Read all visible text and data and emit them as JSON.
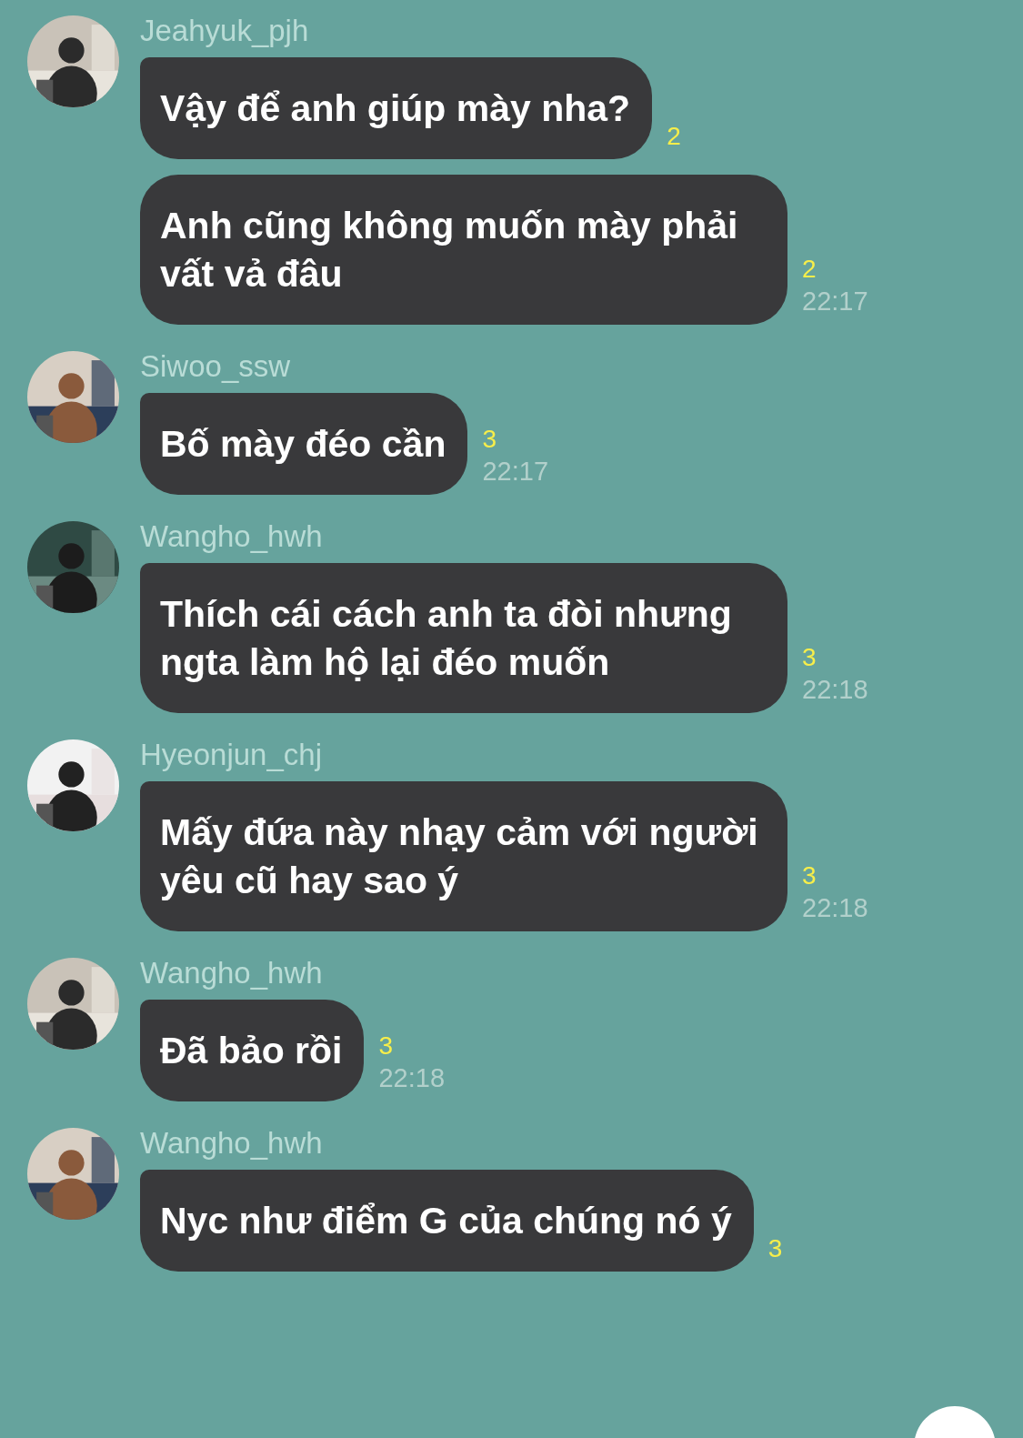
{
  "groups": [
    {
      "sender": "Jeahyuk_pjh",
      "messages": [
        {
          "text": "Vậy để anh giúp mày nha?",
          "read_count": "2"
        },
        {
          "text": "Anh cũng không muốn mày phải vất vả đâu",
          "read_count": "2",
          "time": "22:17"
        }
      ]
    },
    {
      "sender": "Siwoo_ssw",
      "messages": [
        {
          "text": "Bố mày đéo cần",
          "read_count": "3",
          "time": "22:17"
        }
      ]
    },
    {
      "sender": "Wangho_hwh",
      "messages": [
        {
          "text": "Thích cái cách anh ta đòi nhưng ngta làm hộ lại đéo muốn",
          "read_count": "3",
          "time": "22:18"
        }
      ]
    },
    {
      "sender": "Hyeonjun_chj",
      "messages": [
        {
          "text": "Mấy đứa này nhạy cảm với người yêu cũ hay sao ý",
          "read_count": "3",
          "time": "22:18"
        }
      ]
    },
    {
      "sender": "Wangho_hwh",
      "messages": [
        {
          "text": "Đã bảo rồi",
          "read_count": "3",
          "time": "22:18"
        }
      ]
    },
    {
      "sender": "Wangho_hwh",
      "messages": [
        {
          "text": "Nyc như điểm G của chúng nó ý",
          "read_count": "3"
        }
      ]
    }
  ]
}
